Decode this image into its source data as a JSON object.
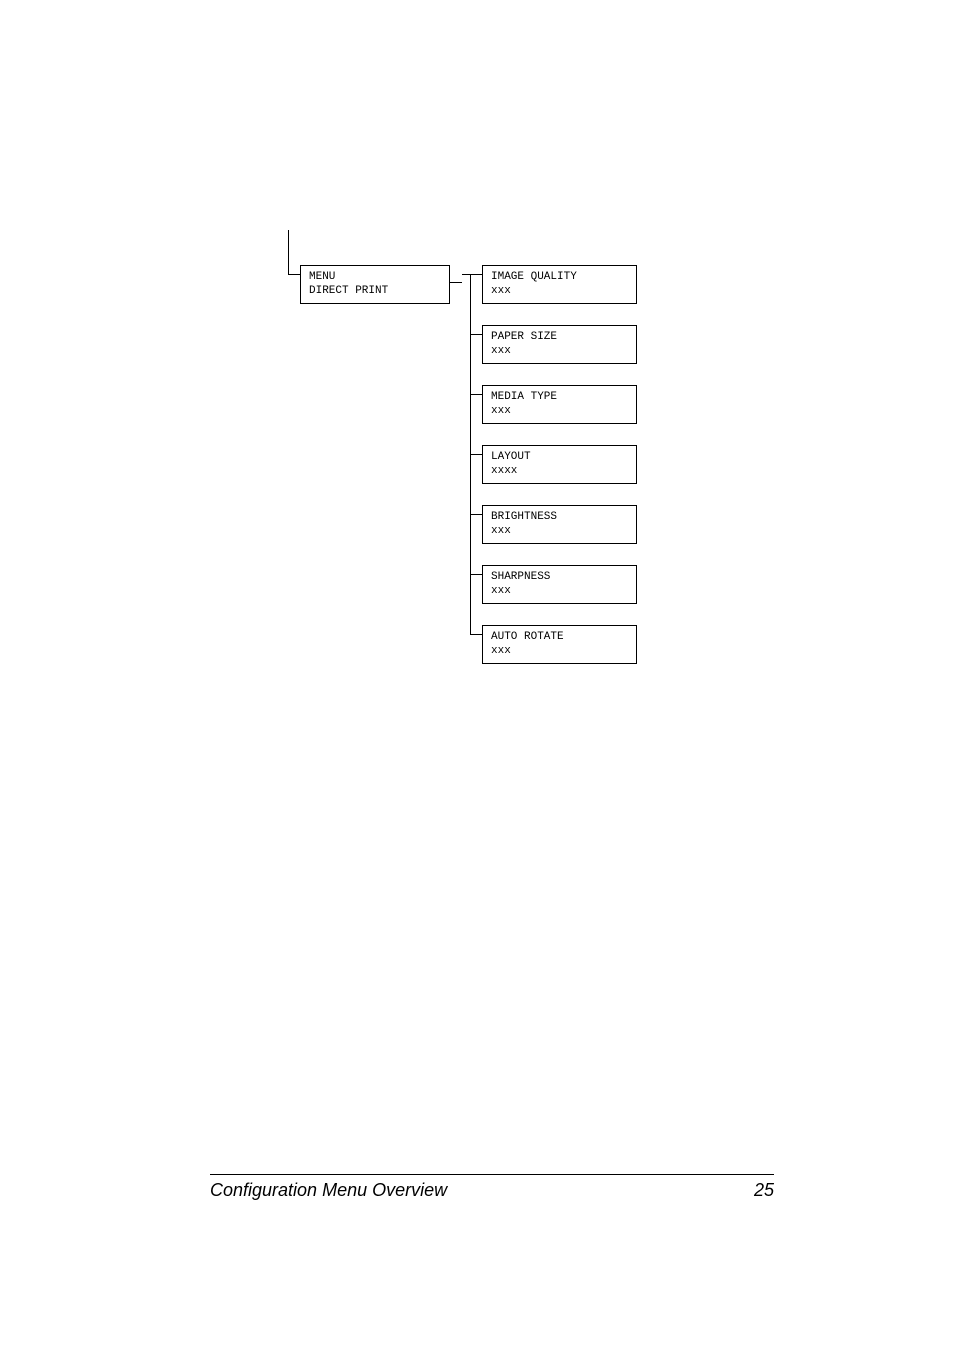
{
  "root_box": {
    "line1": "MENU",
    "line2": "DIRECT PRINT"
  },
  "options": [
    {
      "label": "IMAGE QUALITY",
      "value": "xxx"
    },
    {
      "label": "PAPER SIZE",
      "value": "xxx"
    },
    {
      "label": "MEDIA TYPE",
      "value": "xxx"
    },
    {
      "label": "LAYOUT",
      "value": "xxxx"
    },
    {
      "label": "BRIGHTNESS",
      "value": "xxx"
    },
    {
      "label": "SHARPNESS",
      "value": "xxx"
    },
    {
      "label": "AUTO ROTATE",
      "value": "xxx"
    }
  ],
  "footer": {
    "title": "Configuration Menu Overview",
    "page": "25"
  }
}
